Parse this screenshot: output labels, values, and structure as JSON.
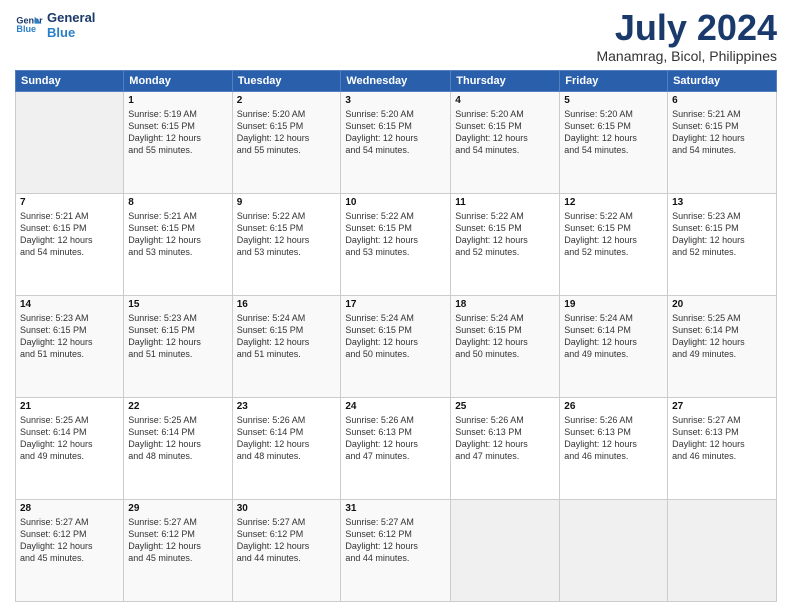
{
  "header": {
    "logo": {
      "line1": "General",
      "line2": "Blue"
    },
    "title": "July 2024",
    "location": "Manamrag, Bicol, Philippines"
  },
  "days_of_week": [
    "Sunday",
    "Monday",
    "Tuesday",
    "Wednesday",
    "Thursday",
    "Friday",
    "Saturday"
  ],
  "weeks": [
    [
      {
        "day": "",
        "info": ""
      },
      {
        "day": "1",
        "info": "Sunrise: 5:19 AM\nSunset: 6:15 PM\nDaylight: 12 hours\nand 55 minutes."
      },
      {
        "day": "2",
        "info": "Sunrise: 5:20 AM\nSunset: 6:15 PM\nDaylight: 12 hours\nand 55 minutes."
      },
      {
        "day": "3",
        "info": "Sunrise: 5:20 AM\nSunset: 6:15 PM\nDaylight: 12 hours\nand 54 minutes."
      },
      {
        "day": "4",
        "info": "Sunrise: 5:20 AM\nSunset: 6:15 PM\nDaylight: 12 hours\nand 54 minutes."
      },
      {
        "day": "5",
        "info": "Sunrise: 5:20 AM\nSunset: 6:15 PM\nDaylight: 12 hours\nand 54 minutes."
      },
      {
        "day": "6",
        "info": "Sunrise: 5:21 AM\nSunset: 6:15 PM\nDaylight: 12 hours\nand 54 minutes."
      }
    ],
    [
      {
        "day": "7",
        "info": "Sunrise: 5:21 AM\nSunset: 6:15 PM\nDaylight: 12 hours\nand 54 minutes."
      },
      {
        "day": "8",
        "info": "Sunrise: 5:21 AM\nSunset: 6:15 PM\nDaylight: 12 hours\nand 53 minutes."
      },
      {
        "day": "9",
        "info": "Sunrise: 5:22 AM\nSunset: 6:15 PM\nDaylight: 12 hours\nand 53 minutes."
      },
      {
        "day": "10",
        "info": "Sunrise: 5:22 AM\nSunset: 6:15 PM\nDaylight: 12 hours\nand 53 minutes."
      },
      {
        "day": "11",
        "info": "Sunrise: 5:22 AM\nSunset: 6:15 PM\nDaylight: 12 hours\nand 52 minutes."
      },
      {
        "day": "12",
        "info": "Sunrise: 5:22 AM\nSunset: 6:15 PM\nDaylight: 12 hours\nand 52 minutes."
      },
      {
        "day": "13",
        "info": "Sunrise: 5:23 AM\nSunset: 6:15 PM\nDaylight: 12 hours\nand 52 minutes."
      }
    ],
    [
      {
        "day": "14",
        "info": "Sunrise: 5:23 AM\nSunset: 6:15 PM\nDaylight: 12 hours\nand 51 minutes."
      },
      {
        "day": "15",
        "info": "Sunrise: 5:23 AM\nSunset: 6:15 PM\nDaylight: 12 hours\nand 51 minutes."
      },
      {
        "day": "16",
        "info": "Sunrise: 5:24 AM\nSunset: 6:15 PM\nDaylight: 12 hours\nand 51 minutes."
      },
      {
        "day": "17",
        "info": "Sunrise: 5:24 AM\nSunset: 6:15 PM\nDaylight: 12 hours\nand 50 minutes."
      },
      {
        "day": "18",
        "info": "Sunrise: 5:24 AM\nSunset: 6:15 PM\nDaylight: 12 hours\nand 50 minutes."
      },
      {
        "day": "19",
        "info": "Sunrise: 5:24 AM\nSunset: 6:14 PM\nDaylight: 12 hours\nand 49 minutes."
      },
      {
        "day": "20",
        "info": "Sunrise: 5:25 AM\nSunset: 6:14 PM\nDaylight: 12 hours\nand 49 minutes."
      }
    ],
    [
      {
        "day": "21",
        "info": "Sunrise: 5:25 AM\nSunset: 6:14 PM\nDaylight: 12 hours\nand 49 minutes."
      },
      {
        "day": "22",
        "info": "Sunrise: 5:25 AM\nSunset: 6:14 PM\nDaylight: 12 hours\nand 48 minutes."
      },
      {
        "day": "23",
        "info": "Sunrise: 5:26 AM\nSunset: 6:14 PM\nDaylight: 12 hours\nand 48 minutes."
      },
      {
        "day": "24",
        "info": "Sunrise: 5:26 AM\nSunset: 6:13 PM\nDaylight: 12 hours\nand 47 minutes."
      },
      {
        "day": "25",
        "info": "Sunrise: 5:26 AM\nSunset: 6:13 PM\nDaylight: 12 hours\nand 47 minutes."
      },
      {
        "day": "26",
        "info": "Sunrise: 5:26 AM\nSunset: 6:13 PM\nDaylight: 12 hours\nand 46 minutes."
      },
      {
        "day": "27",
        "info": "Sunrise: 5:27 AM\nSunset: 6:13 PM\nDaylight: 12 hours\nand 46 minutes."
      }
    ],
    [
      {
        "day": "28",
        "info": "Sunrise: 5:27 AM\nSunset: 6:12 PM\nDaylight: 12 hours\nand 45 minutes."
      },
      {
        "day": "29",
        "info": "Sunrise: 5:27 AM\nSunset: 6:12 PM\nDaylight: 12 hours\nand 45 minutes."
      },
      {
        "day": "30",
        "info": "Sunrise: 5:27 AM\nSunset: 6:12 PM\nDaylight: 12 hours\nand 44 minutes."
      },
      {
        "day": "31",
        "info": "Sunrise: 5:27 AM\nSunset: 6:12 PM\nDaylight: 12 hours\nand 44 minutes."
      },
      {
        "day": "",
        "info": ""
      },
      {
        "day": "",
        "info": ""
      },
      {
        "day": "",
        "info": ""
      }
    ]
  ]
}
